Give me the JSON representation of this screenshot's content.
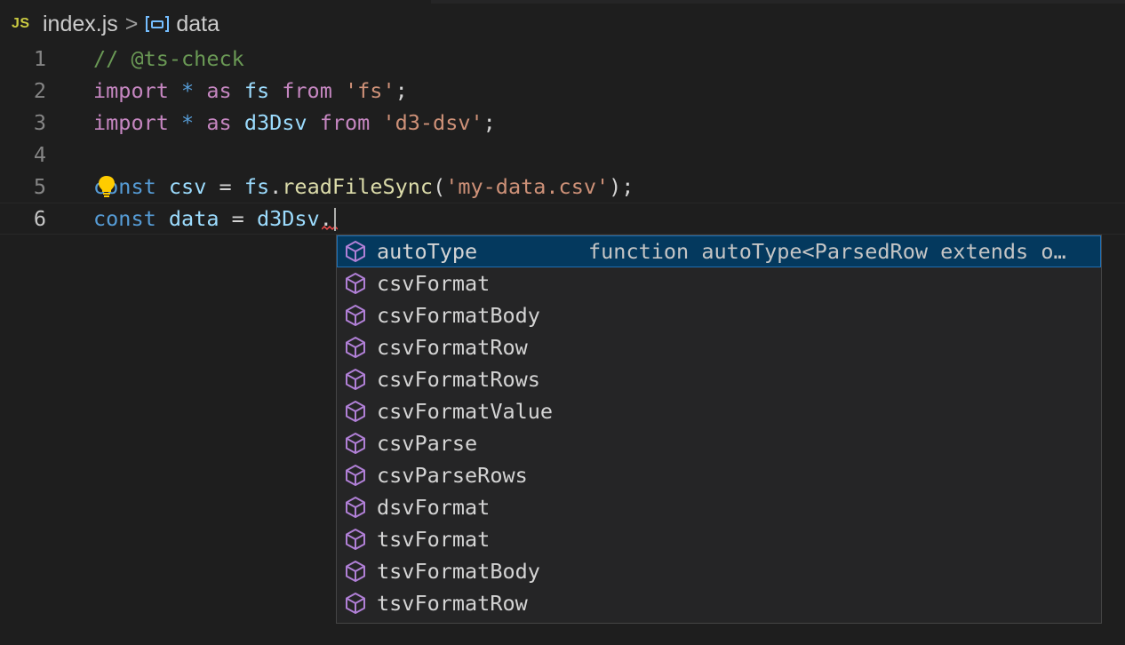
{
  "breadcrumb": {
    "lang_badge": "JS",
    "file": "index.js",
    "separator": ">",
    "symbol": "data",
    "symbol_icon": "variable-symbol-icon"
  },
  "editor": {
    "lines": [
      {
        "number": "1",
        "current": false
      },
      {
        "number": "2",
        "current": false
      },
      {
        "number": "3",
        "current": false
      },
      {
        "number": "4",
        "current": false
      },
      {
        "number": "5",
        "current": false
      },
      {
        "number": "6",
        "current": true
      }
    ],
    "tokens": {
      "l1_comment": "// @ts-check",
      "l2_import": "import",
      "l2_star": "*",
      "l2_as": "as",
      "l2_name": "fs",
      "l2_from": "from",
      "l2_module": "'fs'",
      "l2_semi": ";",
      "l3_import": "import",
      "l3_star": "*",
      "l3_as": "as",
      "l3_name": "d3Dsv",
      "l3_from": "from",
      "l3_module": "'d3-dsv'",
      "l3_semi": ";",
      "l5_const": "const",
      "l5_var": "csv",
      "l5_eq": "=",
      "l5_obj": "fs",
      "l5_dot": ".",
      "l5_fn": "readFileSync",
      "l5_open": "(",
      "l5_arg": "'my-data.csv'",
      "l5_close": ");",
      "l6_const": "const",
      "l6_var": "data",
      "l6_eq": "=",
      "l6_obj": "d3Dsv",
      "l6_dot": "."
    },
    "lightbulb_icon": "lightbulb-icon"
  },
  "suggestions": {
    "item_icon": "module-cube-icon",
    "items": [
      {
        "label": "autoType",
        "detail": "function autoType<ParsedRow extends o…",
        "selected": true
      },
      {
        "label": "csvFormat",
        "detail": ""
      },
      {
        "label": "csvFormatBody",
        "detail": ""
      },
      {
        "label": "csvFormatRow",
        "detail": ""
      },
      {
        "label": "csvFormatRows",
        "detail": ""
      },
      {
        "label": "csvFormatValue",
        "detail": ""
      },
      {
        "label": "csvParse",
        "detail": ""
      },
      {
        "label": "csvParseRows",
        "detail": ""
      },
      {
        "label": "dsvFormat",
        "detail": ""
      },
      {
        "label": "tsvFormat",
        "detail": ""
      },
      {
        "label": "tsvFormatBody",
        "detail": ""
      },
      {
        "label": "tsvFormatRow",
        "detail": ""
      }
    ]
  },
  "colors": {
    "background": "#1e1e1e",
    "comment": "#6a9955",
    "keyword": "#c586c0",
    "variable": "#9cdcfe",
    "string": "#ce9178",
    "function": "#dcdcaa",
    "const_keyword": "#569cd6",
    "cube_icon": "#b180d7",
    "selection": "#04395e"
  }
}
